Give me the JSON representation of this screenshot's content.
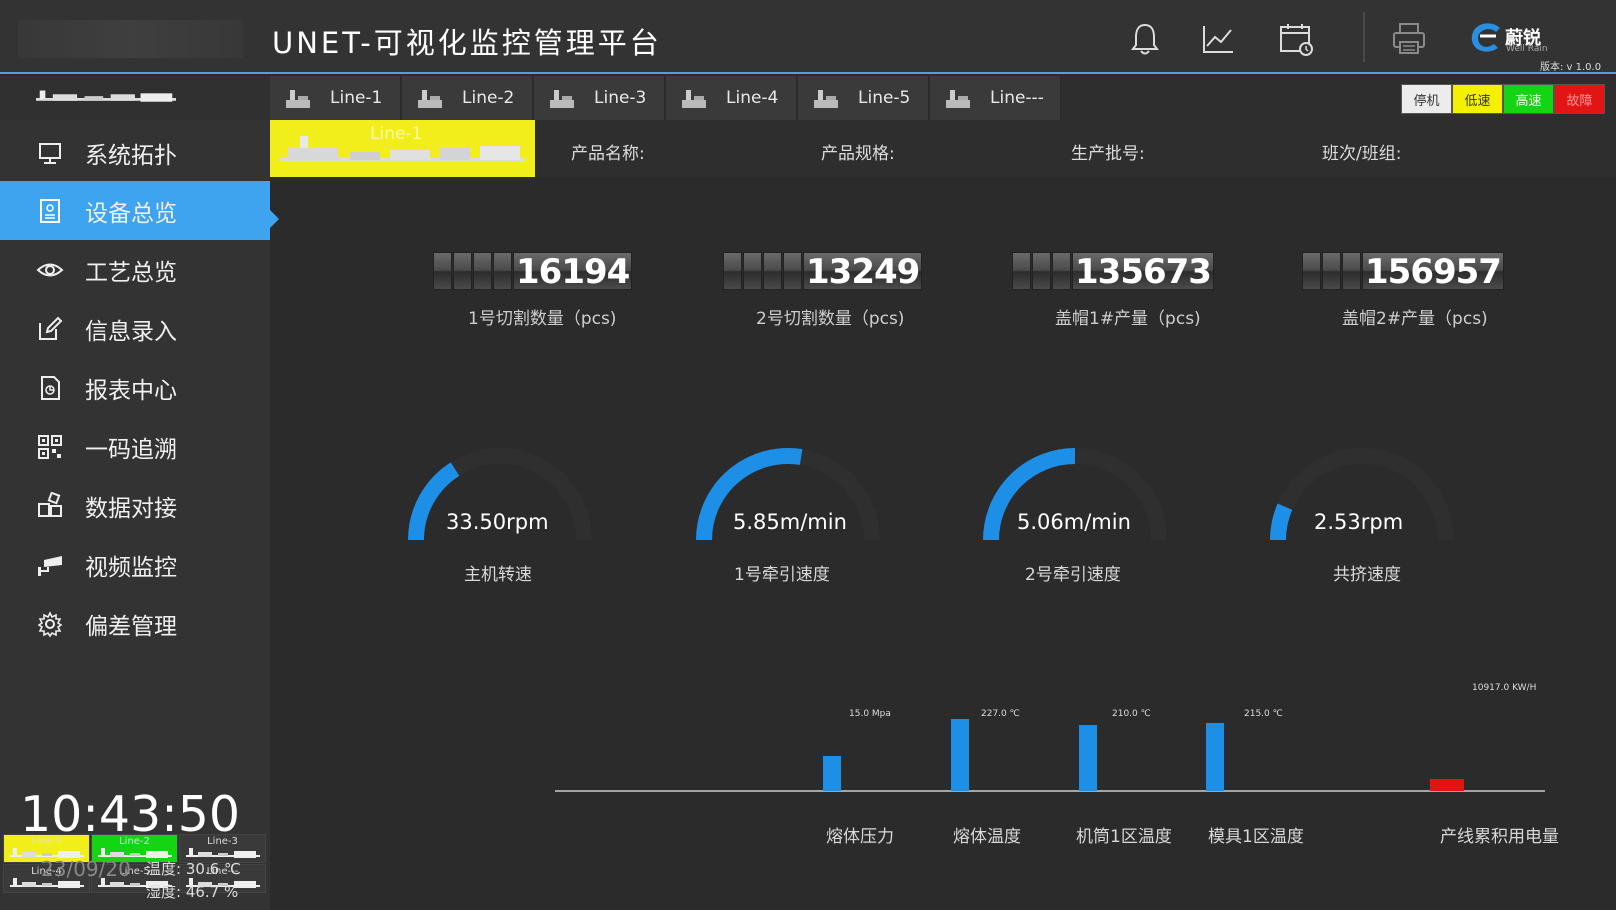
{
  "header": {
    "title": "UNET-可视化监控管理平台",
    "icons": [
      "bell-icon",
      "trend-chart-icon",
      "calendar-icon",
      "printer-icon"
    ],
    "brand_name": "蔚锐",
    "brand_sub": "Well Rain",
    "version": "版本: v 1.0.0"
  },
  "tabs": [
    {
      "label": "Line-1"
    },
    {
      "label": "Line-2"
    },
    {
      "label": "Line-3"
    },
    {
      "label": "Line-4"
    },
    {
      "label": "Line-5"
    },
    {
      "label": "Line---"
    }
  ],
  "status_buttons": [
    {
      "label": "停机",
      "color": "#ececec",
      "text": "#333333"
    },
    {
      "label": "低速",
      "color": "#f5f000",
      "text": "#333333"
    },
    {
      "label": "高速",
      "color": "#14d414",
      "text": "#ffffff"
    },
    {
      "label": "故障",
      "color": "#e31414",
      "text": "#ff9a9a"
    }
  ],
  "sidebar": {
    "items": [
      {
        "label": "系统拓扑",
        "icon": "monitor-icon",
        "active": false
      },
      {
        "label": "设备总览",
        "icon": "device-doc-icon",
        "active": true
      },
      {
        "label": "工艺总览",
        "icon": "eye-icon",
        "active": false
      },
      {
        "label": "信息录入",
        "icon": "edit-icon",
        "active": false
      },
      {
        "label": "报表中心",
        "icon": "report-icon",
        "active": false
      },
      {
        "label": "一码追溯",
        "icon": "qr-code-icon",
        "active": false
      },
      {
        "label": "数据对接",
        "icon": "blocks-icon",
        "active": false
      },
      {
        "label": "视频监控",
        "icon": "camera-icon",
        "active": false
      },
      {
        "label": "偏差管理",
        "icon": "gear-icon",
        "active": false
      }
    ],
    "mini_lines": [
      {
        "label": "Line-1",
        "color": "#f2ee1b"
      },
      {
        "label": "Line-2",
        "color": "#14d414"
      },
      {
        "label": "Line-3",
        "color": "#3a3a3a"
      },
      {
        "label": "Line-4",
        "color": "#3a3a3a"
      },
      {
        "label": "Line-5",
        "color": "#3a3a3a"
      },
      {
        "label": "Line---",
        "color": "#3a3a3a"
      }
    ],
    "time": "10:43:50",
    "date": "23/09/20",
    "temperature": "温度:  30.6  ℃",
    "humidity": "湿度:  46.7   %"
  },
  "main": {
    "line_banner": "Line-1",
    "info": {
      "product_name": "产品名称:",
      "product_spec": "产品规格:",
      "batch": "生产批号:",
      "shift": "班次/班组:"
    },
    "counters": [
      {
        "value": "16194",
        "label": "1号切割数量（pcs)",
        "pad": 4
      },
      {
        "value": "13249",
        "label": "2号切割数量（pcs)",
        "pad": 4
      },
      {
        "value": "135673",
        "label": "盖帽1#产量（pcs)",
        "pad": 3
      },
      {
        "value": "156957",
        "label": "盖帽2#产量（pcs)",
        "pad": 3
      }
    ],
    "gauges": [
      {
        "value_text": "33.50rpm",
        "label": "主机转速",
        "fraction": 0.32
      },
      {
        "value_text": "5.85m/min",
        "label": "1号牵引速度",
        "fraction": 0.55
      },
      {
        "value_text": "5.06m/min",
        "label": "2号牵引速度",
        "fraction": 0.5
      },
      {
        "value_text": "2.53rpm",
        "label": "共挤速度",
        "fraction": 0.13
      }
    ],
    "accent": "#1e8fe6",
    "track": "#2f2f2f"
  },
  "chart_data": {
    "type": "bar",
    "categories": [
      "熔体压力",
      "熔体温度",
      "机筒1区温度",
      "模具1区温度",
      "产线累积用电量"
    ],
    "value_labels": [
      "15.0 Mpa",
      "227.0 ℃",
      "210.0 ℃",
      "215.0 ℃",
      "10917.0 KW/H"
    ],
    "values": [
      15.0,
      227.0,
      210.0,
      215.0,
      10917.0
    ],
    "bar_fraction": [
      0.35,
      0.72,
      0.66,
      0.68,
      0.12
    ],
    "colors": [
      "#1e8fe6",
      "#1e8fe6",
      "#1e8fe6",
      "#1e8fe6",
      "#e31414"
    ]
  }
}
